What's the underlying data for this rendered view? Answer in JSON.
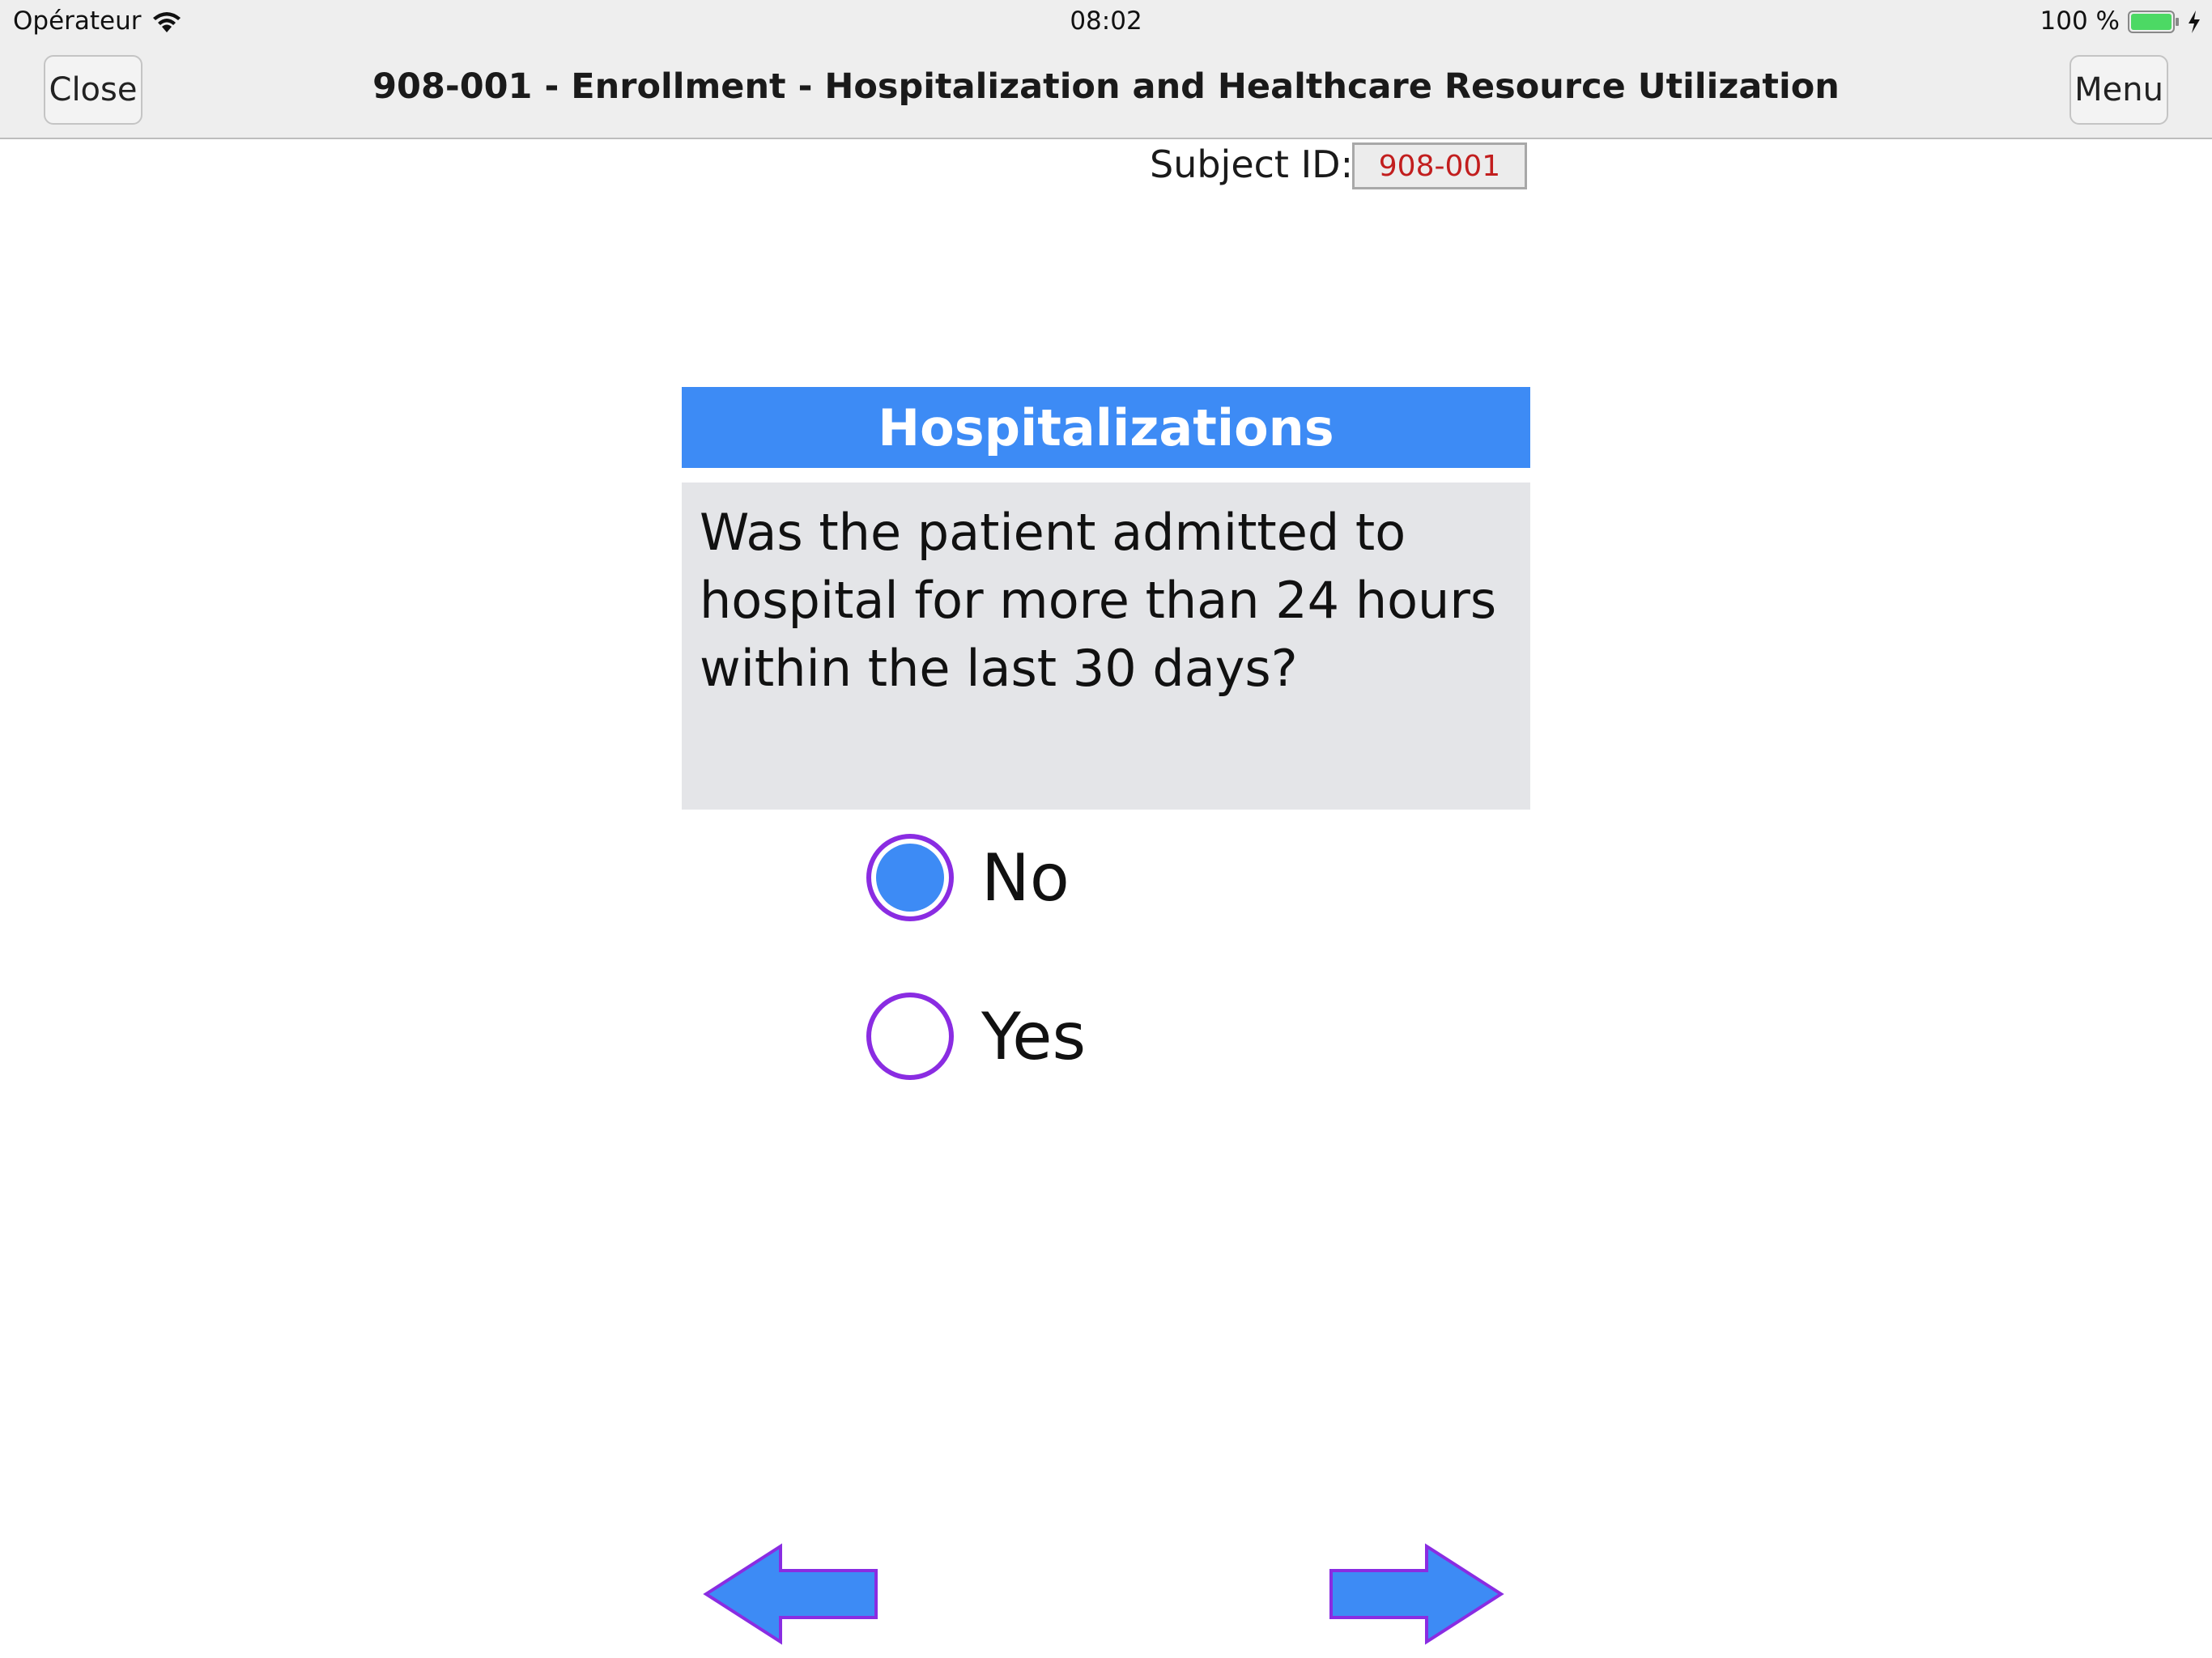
{
  "status_bar": {
    "carrier": "Opérateur",
    "time": "08:02",
    "battery_percent": "100 %",
    "icons": [
      "wifi-icon",
      "battery-icon",
      "charging-icon"
    ],
    "battery_level": 1.0
  },
  "nav": {
    "close_label": "Close",
    "title": "908-001  - Enrollment - Hospitalization and Healthcare Resource Utilization",
    "menu_label": "Menu"
  },
  "subject": {
    "label": "Subject ID:",
    "value": "908-001"
  },
  "section": {
    "title": "Hospitalizations",
    "question": "Was the patient admitted to hospital for more than 24 hours within the last 30 days?"
  },
  "options": [
    {
      "label": "No",
      "selected": true
    },
    {
      "label": "Yes",
      "selected": false
    }
  ],
  "navigation_arrows": {
    "back_icon": "arrow-left-icon",
    "next_icon": "arrow-right-icon"
  },
  "colors": {
    "accent_blue": "#3d8bf5",
    "radio_border": "#8a2ce2",
    "subject_id_text": "#c21e1e",
    "battery_green": "#4cd964"
  }
}
